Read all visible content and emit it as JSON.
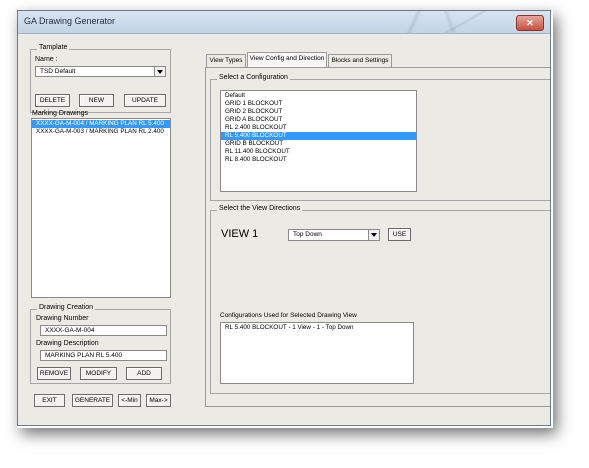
{
  "window": {
    "title": "GA Drawing Generator"
  },
  "template": {
    "group_title": "Tamplate",
    "name_label": "Name :",
    "name_value": "TSD Default",
    "delete_label": "DELETE",
    "new_label": "NEW",
    "update_label": "UPDATE"
  },
  "marking": {
    "label": "Marking Drawings",
    "items": [
      {
        "text": "XXXX-GA-M-004 / MARKING PLAN RL 5.400",
        "selected": true
      },
      {
        "text": "XXXX-GA-M-003 / MARKING PLAN RL 2.400",
        "selected": false
      }
    ]
  },
  "creation": {
    "group_title": "Drawing Creation",
    "number_label": "Drawing Number",
    "number_value": "XXXX-GA-M-004",
    "desc_label": "Drawing Description",
    "desc_value": "MARKING PLAN RL 5.400",
    "remove_label": "REMOVE",
    "modify_label": "MODIFY",
    "add_label": "ADD"
  },
  "bottom": {
    "exit_label": "EXIT",
    "generate_label": "GENERATE",
    "min_label": "<-Min",
    "max_label": "Max->"
  },
  "tabs": [
    "View Types",
    "View Config and Direction",
    "Blocks and Settings"
  ],
  "config": {
    "group_title": "Select a Configuration",
    "items": [
      {
        "text": "Default",
        "selected": false
      },
      {
        "text": "GRID 1 BLOCKOUT",
        "selected": false
      },
      {
        "text": "GRID 2 BLOCKOUT",
        "selected": false
      },
      {
        "text": "GRID A BLOCKOUT",
        "selected": false
      },
      {
        "text": "RL 2.400 BLOCKOUT",
        "selected": false
      },
      {
        "text": "RL 5.400 BLOCKOUT",
        "selected": true
      },
      {
        "text": "GRID B BLOCKOUT",
        "selected": false
      },
      {
        "text": "RL 11.400 BLOCKOUT",
        "selected": false
      },
      {
        "text": "RL 8.400 BLOCKOUT",
        "selected": false
      }
    ]
  },
  "directions": {
    "group_title": "Select the View Directions",
    "view_label": "VIEW 1",
    "view_value": "Top Down",
    "use_label": "USE",
    "used_label": "Configurations Used for Selected Drawing View",
    "used_items": [
      "RL 5.400 BLOCKOUT - 1 View - 1 - Top Down"
    ]
  }
}
